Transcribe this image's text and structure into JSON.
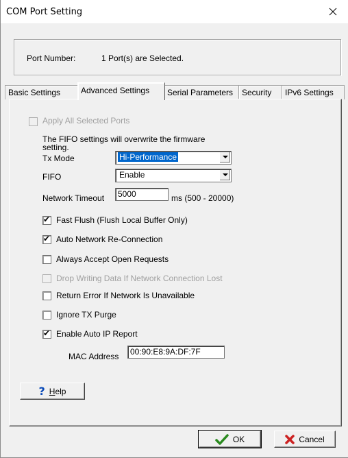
{
  "window": {
    "title": "COM Port Setting",
    "close_icon": "close-icon"
  },
  "port": {
    "label": "Port Number:",
    "value": "1 Port(s) are Selected."
  },
  "tabs": [
    {
      "label": "Basic Settings",
      "active": false
    },
    {
      "label": "Advanced Settings",
      "active": true
    },
    {
      "label": "Serial Parameters",
      "active": false
    },
    {
      "label": "Security",
      "active": false
    },
    {
      "label": "IPv6 Settings",
      "active": false
    }
  ],
  "advanced": {
    "apply_all_label": "Apply All Selected Ports",
    "fifo_note_line1": "The FIFO settings will overwrite the firmware",
    "fifo_note_line2": "setting.",
    "tx_mode_label": "Tx Mode",
    "tx_mode_value": "Hi-Performance",
    "fifo_label": "FIFO",
    "fifo_value": "Enable",
    "network_timeout_label": "Network Timeout",
    "network_timeout_value": "5000",
    "network_timeout_range": "ms (500 - 20000)",
    "options": [
      {
        "label": "Fast Flush (Flush Local Buffer Only)",
        "checked": true,
        "enabled": true
      },
      {
        "label": "Auto Network Re-Connection",
        "checked": true,
        "enabled": true
      },
      {
        "label": "Always Accept Open Requests",
        "checked": false,
        "enabled": true
      },
      {
        "label": "Drop Writing Data If Network Connection Lost",
        "checked": false,
        "enabled": false
      },
      {
        "label": "Return Error If Network Is Unavailable",
        "checked": false,
        "enabled": true
      },
      {
        "label": "Ignore TX Purge",
        "checked": false,
        "enabled": true
      },
      {
        "label": "Enable Auto IP Report",
        "checked": true,
        "enabled": true
      }
    ],
    "mac_label": "MAC Address",
    "mac_value": "00:90:E8:9A:DF:7F"
  },
  "buttons": {
    "help_rest": "elp",
    "help_accel": "H",
    "help_icon": "question-mark-icon",
    "ok_label": "OK",
    "ok_icon": "checkmark-icon",
    "ok_color": "#2a8a1f",
    "cancel_label": "Cancel",
    "cancel_icon": "x-icon",
    "cancel_color": "#cc2222"
  }
}
